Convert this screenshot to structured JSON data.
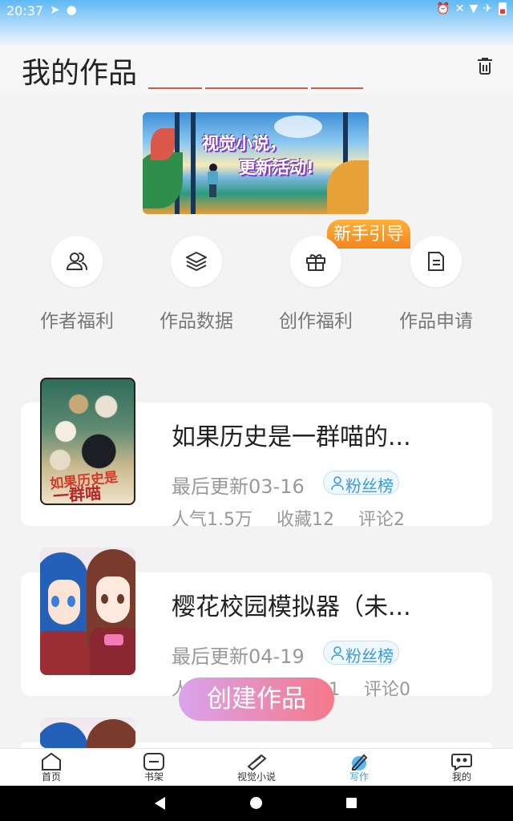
{
  "status_bar": {
    "time": "20:37",
    "left_icons": [
      "send-icon",
      "circle-notification-icon"
    ],
    "right_icons": [
      "alarm-icon",
      "mute-icon",
      "wifi-icon",
      "airplane-icon",
      "battery-low-icon"
    ]
  },
  "header": {
    "title": "我的作品"
  },
  "banner": {
    "caption_line1": "视觉小说，",
    "caption_line2": "更新活动!"
  },
  "guide_badge": "新手引导",
  "quick_actions": [
    {
      "label": "作者福利",
      "icon": "users-icon"
    },
    {
      "label": "作品数据",
      "icon": "layers-icon"
    },
    {
      "label": "创作福利",
      "icon": "gift-icon"
    },
    {
      "label": "作品申请",
      "icon": "document-icon"
    }
  ],
  "works": [
    {
      "title": "如果历史是一群喵的...",
      "updated": "最后更新03-16",
      "fans_label": "粉丝榜",
      "popularity": "人气1.5万",
      "favorites": "收藏12",
      "comments": "评论2",
      "cover_text_1": "如果历史是",
      "cover_text_2": "一群喵"
    },
    {
      "title": "樱花校园模拟器（未...",
      "updated": "最后更新04-19",
      "fans_label": "粉丝榜",
      "popularity": "人",
      "favorites": "11",
      "comments": "评论0"
    }
  ],
  "create_button": "创建作品",
  "tabs": [
    {
      "label": "首页",
      "icon": "home-icon",
      "active": false
    },
    {
      "label": "书架",
      "icon": "bookshelf-icon",
      "active": false
    },
    {
      "label": "视觉小说",
      "icon": "book-icon",
      "active": false
    },
    {
      "label": "写作",
      "icon": "pen-icon",
      "active": true
    },
    {
      "label": "我的",
      "icon": "chat-bubble-icon",
      "active": false
    }
  ],
  "colors": {
    "accent": "#3aa0e8",
    "create_gradient_start": "#d9a4ec",
    "create_gradient_end": "#f6788a",
    "guide_orange": "#f5841d"
  }
}
